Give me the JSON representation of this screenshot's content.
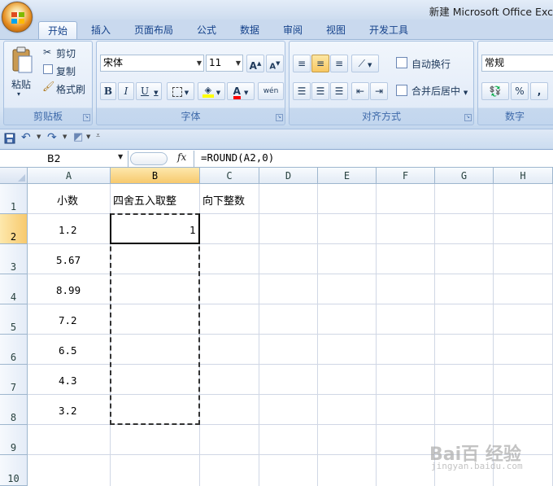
{
  "window": {
    "title": "新建 Microsoft Office Exc"
  },
  "tabs": [
    {
      "label": "开始",
      "active": true
    },
    {
      "label": "插入"
    },
    {
      "label": "页面布局"
    },
    {
      "label": "公式"
    },
    {
      "label": "数据"
    },
    {
      "label": "审阅"
    },
    {
      "label": "视图"
    },
    {
      "label": "开发工具"
    }
  ],
  "ribbon": {
    "clipboard": {
      "paste": "粘贴",
      "cut": "剪切",
      "copy": "复制",
      "format_painter": "格式刷",
      "label": "剪贴板"
    },
    "font": {
      "name": "宋体",
      "size": "11",
      "label": "字体",
      "bold": "B",
      "italic": "I",
      "underline": "U",
      "grow": "A",
      "shrink": "A",
      "font_color": "A",
      "phonetic": "wén"
    },
    "alignment": {
      "wrap": "自动换行",
      "merge": "合并后居中",
      "label": "对齐方式"
    },
    "number": {
      "format": "常规",
      "percent": "%",
      "comma": ",",
      "label": "数字"
    }
  },
  "formula_bar": {
    "name_box": "B2",
    "fx": "fx",
    "formula": "=ROUND(A2,0)"
  },
  "columns": [
    "A",
    "B",
    "C",
    "D",
    "E",
    "F",
    "G",
    "H"
  ],
  "rows": [
    "1",
    "2",
    "3",
    "4",
    "5",
    "6",
    "7",
    "8",
    "9",
    "10"
  ],
  "cells": {
    "A1": "小数",
    "B1": "四舍五入取整",
    "C1": "向下整数",
    "A2": "1.2",
    "A3": "5.67",
    "A4": "8.99",
    "A5": "7.2",
    "A6": "6.5",
    "A7": "4.3",
    "A8": "3.2",
    "B2": "1"
  },
  "active_cell": "B2",
  "watermark": {
    "main": "Bai百 经验",
    "sub": "jingyan.baidu.com"
  }
}
